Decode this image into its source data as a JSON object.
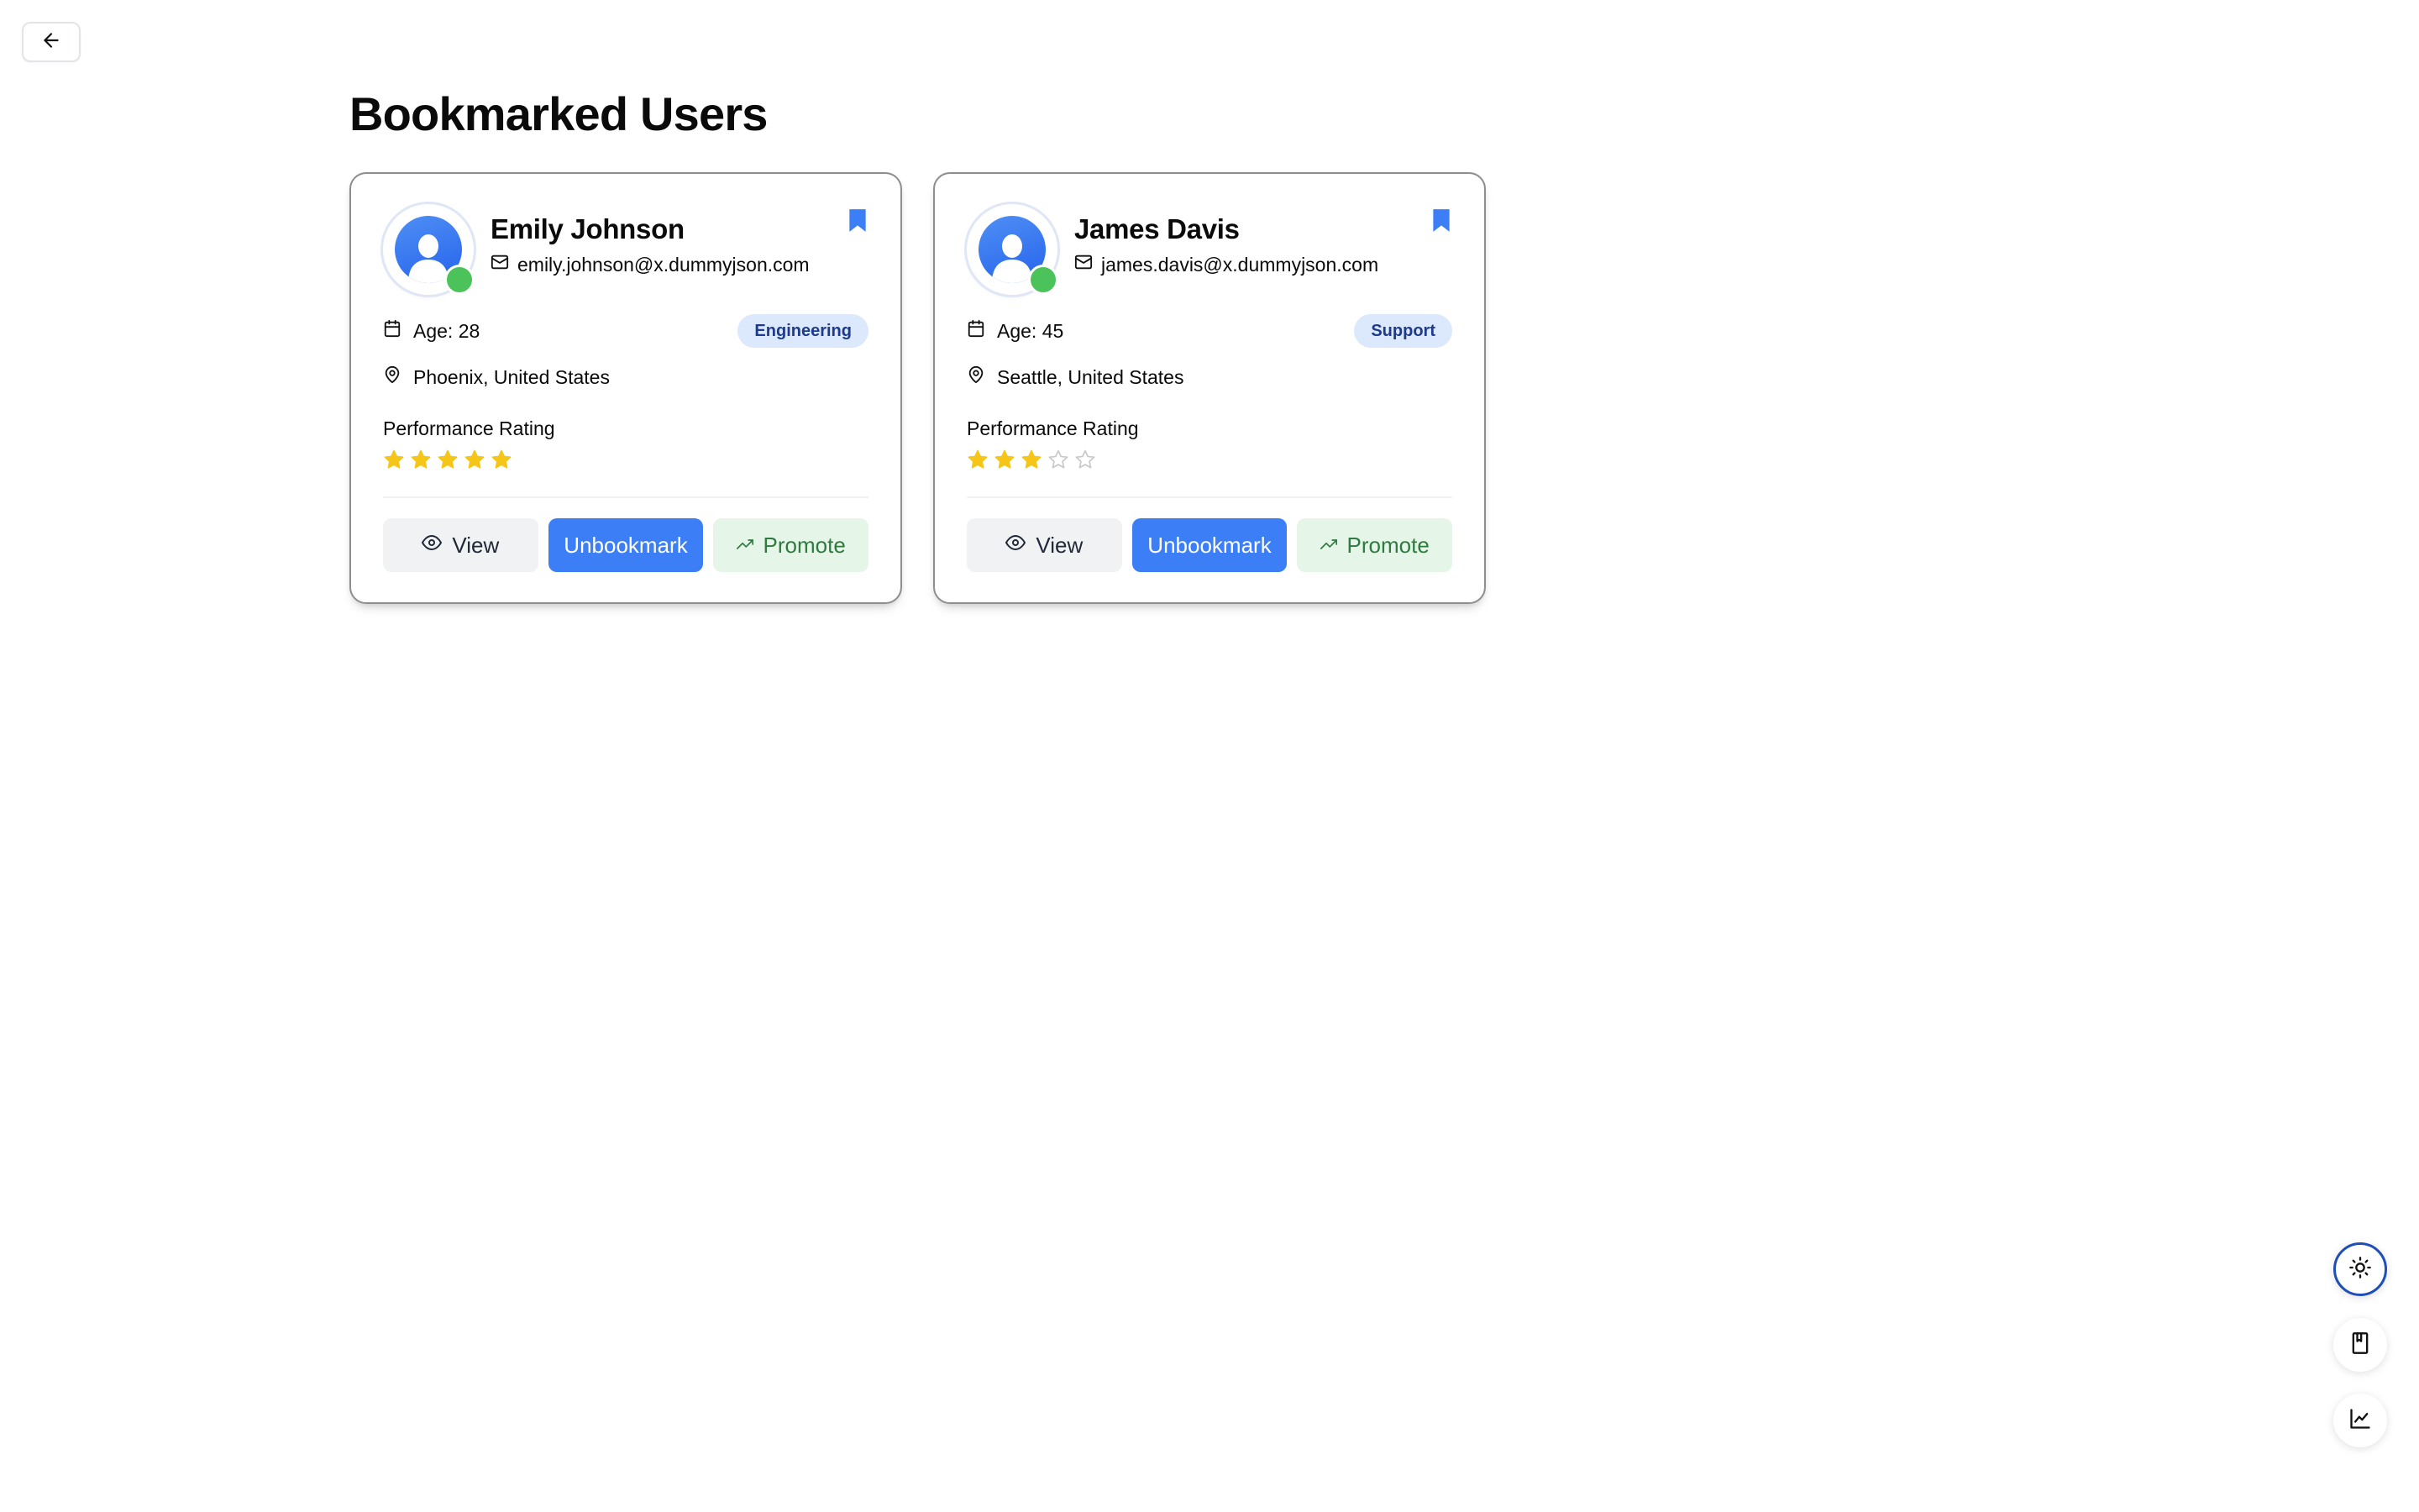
{
  "page": {
    "title": "Bookmarked Users"
  },
  "users": [
    {
      "name": "Emily Johnson",
      "email": "emily.johnson@x.dummyjson.com",
      "age_label": "Age: 28",
      "department": "Engineering",
      "location": "Phoenix, United States",
      "rating_label": "Performance Rating",
      "rating": 5,
      "rating_max": 5,
      "online": true
    },
    {
      "name": "James Davis",
      "email": "james.davis@x.dummyjson.com",
      "age_label": "Age: 45",
      "department": "Support",
      "location": "Seattle, United States",
      "rating_label": "Performance Rating",
      "rating": 3,
      "rating_max": 5,
      "online": true
    }
  ],
  "actions": {
    "view": "View",
    "unbookmark": "Unbookmark",
    "promote": "Promote"
  },
  "icons": {
    "back": "arrow-left-icon",
    "theme": "sun-icon",
    "bookmarks": "bookmark-icon",
    "analytics": "chart-line-icon"
  },
  "colors": {
    "primary": "#3b7ef6",
    "star": "#f5c518",
    "online": "#4cc25b",
    "promote_bg": "#e5f6e9",
    "promote_text": "#2f7b3f",
    "badge_bg": "#dce8fb",
    "badge_text": "#1e3a8a"
  }
}
